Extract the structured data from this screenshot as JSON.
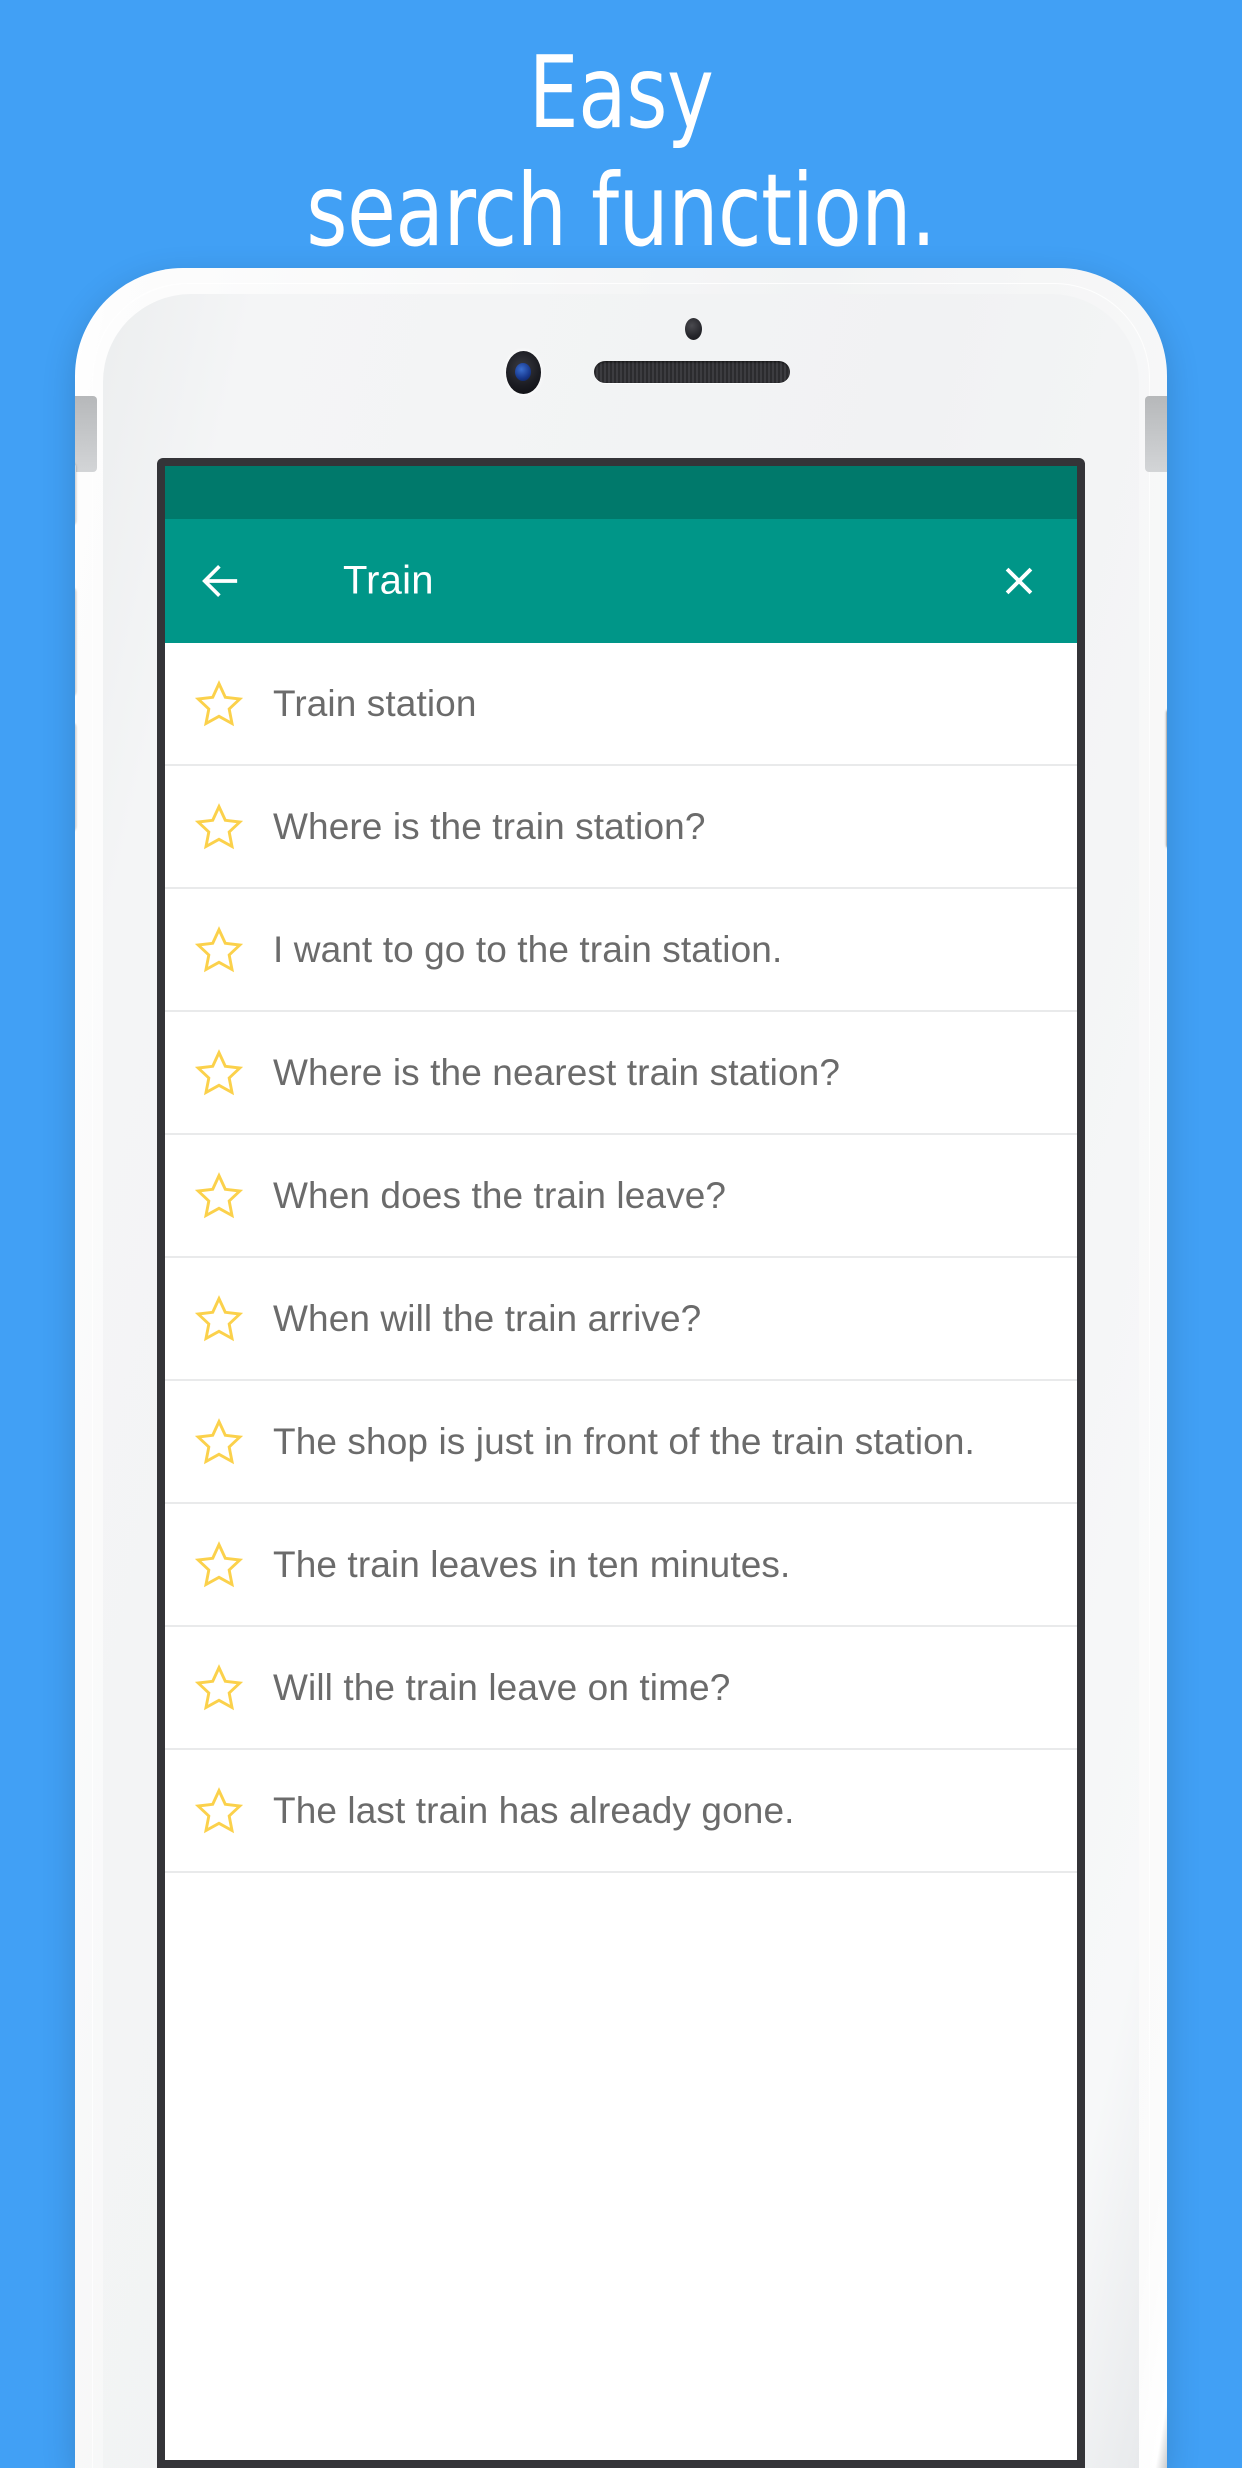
{
  "promo": {
    "headline_line1": "Easy",
    "headline_line2": "search function.",
    "background_color": "#41a0f5",
    "headline_color": "#ffffff"
  },
  "device": {
    "name": "white-smartphone-mockup",
    "hardware": {
      "sensor": "proximity-sensor",
      "camera": "front-camera",
      "speaker": "earpiece-speaker",
      "buttons": [
        "mute-switch",
        "volume-up",
        "volume-down",
        "power"
      ]
    }
  },
  "app": {
    "status_bar_color": "#00796b",
    "app_bar_color": "#009688",
    "back_icon": "arrow-left-icon",
    "title": "Train",
    "close_icon": "close-icon",
    "star_icon": "star-outline-icon",
    "star_color": "#fbd14b",
    "text_color": "#6b6b6b",
    "results": [
      {
        "text": "Train station"
      },
      {
        "text": "Where is the train station?"
      },
      {
        "text": "I want to go to the train station."
      },
      {
        "text": "Where is the nearest train station?"
      },
      {
        "text": "When does the train leave?"
      },
      {
        "text": "When will the train arrive?"
      },
      {
        "text": "The shop is just in front of the train station."
      },
      {
        "text": "The train leaves in ten minutes."
      },
      {
        "text": "Will the train leave on time?"
      },
      {
        "text": "The last train has already gone."
      }
    ]
  }
}
